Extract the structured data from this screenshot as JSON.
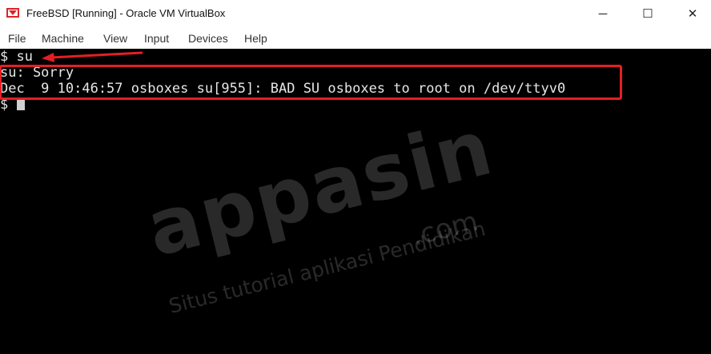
{
  "window": {
    "title": "FreeBSD [Running] - Oracle VM VirtualBox",
    "icon": "virtualbox-icon",
    "controls": {
      "minimize": "─",
      "maximize": "☐",
      "close": "✕"
    }
  },
  "menubar": {
    "items": [
      "File",
      "Machine",
      "View",
      "Input",
      "Devices",
      "Help"
    ]
  },
  "terminal": {
    "lines": [
      "$ su",
      "su: Sorry",
      "Dec  9 10:46:57 osboxes su[955]: BAD SU osboxes to root on /dev/ttyv0",
      "$ "
    ],
    "cursor": "block"
  },
  "annotations": {
    "color": "#e41f24"
  },
  "watermark": {
    "brand": "appasin",
    "domain": ".com",
    "tagline": "Situs tutorial aplikasi Pendidikan"
  }
}
